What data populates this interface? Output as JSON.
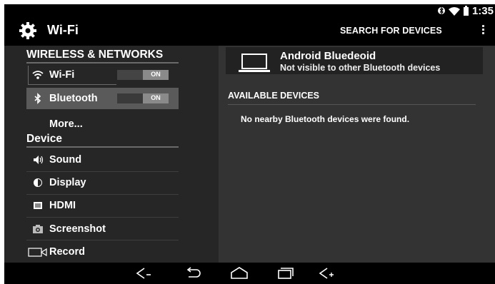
{
  "status_bar": {
    "time": "1:35",
    "icons": [
      "bluetooth-icon",
      "wifi-signal-icon",
      "battery-icon"
    ]
  },
  "action_bar": {
    "title": "Wi-Fi",
    "search_label": "SEARCH FOR DEVICES",
    "icon": "gear-icon"
  },
  "sidebar": {
    "section_wireless": "WIRELESS & NETWORKS",
    "section_device": "Device",
    "items": [
      {
        "label": "Wi-Fi",
        "icon": "wifi-icon",
        "toggle": "ON"
      },
      {
        "label": "Bluetooth",
        "icon": "bluetooth-icon",
        "toggle": "ON",
        "selected": true
      },
      {
        "label": "More..."
      },
      {
        "label": "Sound",
        "icon": "speaker-icon"
      },
      {
        "label": "Display",
        "icon": "brightness-icon"
      },
      {
        "label": "HDMI",
        "icon": "hdmi-icon"
      },
      {
        "label": "Screenshot",
        "icon": "camera-icon"
      },
      {
        "label": "Record",
        "icon": "video-camera-icon"
      }
    ]
  },
  "bluetooth": {
    "device_name": "Android Bluedeoid",
    "device_status": "Not visible to other Bluetooth devices",
    "available_header": "AVAILABLE DEVICES",
    "empty_message": "No nearby  Bluetooth devices were found."
  },
  "nav_bar": {
    "buttons": [
      "volume-down-icon",
      "back-icon",
      "home-icon",
      "recent-apps-icon",
      "volume-up-icon"
    ]
  }
}
